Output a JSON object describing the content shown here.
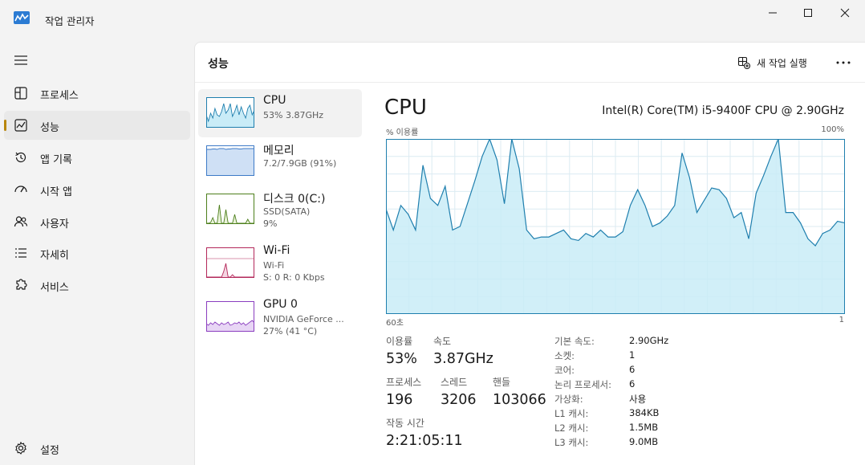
{
  "window": {
    "title": "작업 관리자"
  },
  "sidebar": {
    "items": [
      {
        "label": "프로세스"
      },
      {
        "label": "성능"
      },
      {
        "label": "앱 기록"
      },
      {
        "label": "시작 앱"
      },
      {
        "label": "사용자"
      },
      {
        "label": "자세히"
      },
      {
        "label": "서비스"
      }
    ],
    "settings_label": "설정",
    "accent_color": "#b8860b"
  },
  "header": {
    "title": "성능",
    "new_task_label": "새 작업 실행"
  },
  "devices": [
    {
      "name": "CPU",
      "line1": "53% 3.87GHz",
      "line2": "",
      "color": "#1f7fae",
      "fill": "#c9ecf7"
    },
    {
      "name": "메모리",
      "line1": "7.2/7.9GB (91%)",
      "line2": "",
      "color": "#3d7ac7",
      "fill": "#cfe0f5"
    },
    {
      "name": "디스크 0(C:)",
      "line1": "SSD(SATA)",
      "line2": "9%",
      "color": "#4d7f1c",
      "fill": "#e8f2d8"
    },
    {
      "name": "Wi-Fi",
      "line1": "Wi-Fi",
      "line2": "S: 0 R: 0 Kbps",
      "color": "#b3285a",
      "fill": "#f5d6e2"
    },
    {
      "name": "GPU 0",
      "line1": "NVIDIA GeForce ...",
      "line2": "27% (41 °C)",
      "color": "#8a3dbf",
      "fill": "#e8d6f5"
    }
  ],
  "detail": {
    "title": "CPU",
    "model": "Intel(R) Core(TM) i5-9400F CPU @ 2.90GHz",
    "y_axis_label": "% 이용률",
    "y_axis_max": "100%",
    "x_axis_left": "60초",
    "x_axis_right": "1",
    "stats": {
      "utilization_label": "이용률",
      "utilization_value": "53%",
      "speed_label": "속도",
      "speed_value": "3.87GHz",
      "processes_label": "프로세스",
      "processes_value": "196",
      "threads_label": "스레드",
      "threads_value": "3206",
      "handles_label": "핸들",
      "handles_value": "103066",
      "uptime_label": "작동 시간",
      "uptime_value": "2:21:05:11"
    },
    "specs": [
      {
        "label": "기본 속도:",
        "value": "2.90GHz"
      },
      {
        "label": "소켓:",
        "value": "1"
      },
      {
        "label": "코어:",
        "value": "6"
      },
      {
        "label": "논리 프로세서:",
        "value": "6"
      },
      {
        "label": "가상화:",
        "value": "사용"
      },
      {
        "label": "L1 캐시:",
        "value": "384KB"
      },
      {
        "label": "L2 캐시:",
        "value": "1.5MB"
      },
      {
        "label": "L3 캐시:",
        "value": "9.0MB"
      }
    ]
  },
  "chart_data": {
    "type": "area",
    "x": [
      60,
      59,
      58,
      57,
      56,
      55,
      54,
      53,
      52,
      51,
      50,
      49,
      48,
      47,
      46,
      45,
      44,
      43,
      42,
      41,
      40,
      39,
      38,
      37,
      36,
      35,
      34,
      33,
      32,
      31,
      30,
      29,
      28,
      27,
      26,
      25,
      24,
      23,
      22,
      21,
      20,
      19,
      18,
      17,
      16,
      15,
      14,
      13,
      12,
      11,
      10,
      9,
      8,
      7,
      6,
      5,
      4,
      3,
      2,
      1
    ],
    "series": [
      {
        "values": [
          60,
          48,
          62,
          57,
          48,
          85,
          66,
          62,
          73,
          48,
          50,
          63,
          76,
          90,
          100,
          88,
          63,
          100,
          83,
          48,
          43,
          44,
          44,
          46,
          48,
          43,
          42,
          46,
          44,
          48,
          44,
          44,
          47,
          62,
          71,
          62,
          50,
          52,
          56,
          62,
          92,
          78,
          58,
          65,
          72,
          71,
          66,
          55,
          58,
          43,
          69,
          79,
          90,
          100,
          58,
          58,
          52,
          43,
          39,
          46,
          48,
          53,
          52
        ]
      }
    ],
    "ylim": [
      0,
      100
    ],
    "colors": {
      "line": "#1f7fae",
      "fill": "#c9ecf7",
      "grid": "#dcebf2"
    }
  }
}
